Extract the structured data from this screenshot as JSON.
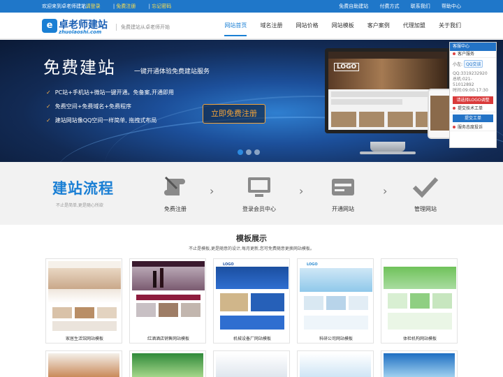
{
  "topbar": {
    "welcome": "欢迎来到卓老师建站,",
    "login": "请登录",
    "register": "免费注册",
    "forgot": "忘记密码",
    "right_links": [
      "免费自助建站",
      "付费方式",
      "联系我们",
      "帮助中心"
    ]
  },
  "header": {
    "logo_cn": "卓老师建站",
    "logo_en": "zhuolaoshi.com",
    "slogan": "免费建站从卓老师开始",
    "nav": [
      "网站首页",
      "域名注册",
      "网站价格",
      "网站模板",
      "客户案例",
      "代理加盟",
      "关于我们"
    ],
    "active_nav": "网站首页"
  },
  "banner": {
    "title": "免费建站",
    "subtitle": "一键开通体验免费建站服务",
    "features": [
      "PC站+手机站+微站一键开通。免备案,开通即用",
      "免费空间+免费域名+免费程序",
      "建站网站像QQ空间一样简单, 拖拽式布局"
    ],
    "cta": "立即免费注册",
    "mock_logo": "LOGO"
  },
  "service_panel": {
    "title": "客服中心",
    "section1": "客户服务",
    "agent": "小左:",
    "qq_button": "QQ交谈",
    "qq_line": "QQ:3319232920",
    "phone_line": "总机:021-51012892",
    "hours_line": "时间:09:00-17:30",
    "red_button": "请选择LOGO调整",
    "section2": "提交技术工单",
    "submit_button": "提交工单",
    "section3": "服务态度投诉"
  },
  "process": {
    "title": "建站流程",
    "desc": "不止是简单,更是随心所欲",
    "steps": [
      "免费注册",
      "登录会员中心",
      "开通网站",
      "管理网站"
    ]
  },
  "templates": {
    "title": "模板展示",
    "desc": "不止是模板,更是随意的设计,每月更新,您可免费随意更换网站模板。",
    "items": [
      "家居生活馆网站模板",
      "红酒酒店销售网站模板",
      "机械设备厂网站模板",
      "科研公司网站模板",
      "体检机构网站模板"
    ]
  },
  "colors": {
    "brand_blue": "#1f77c9",
    "accent_orange": "#f2a33a",
    "process_bg": "#f2f2f2"
  }
}
